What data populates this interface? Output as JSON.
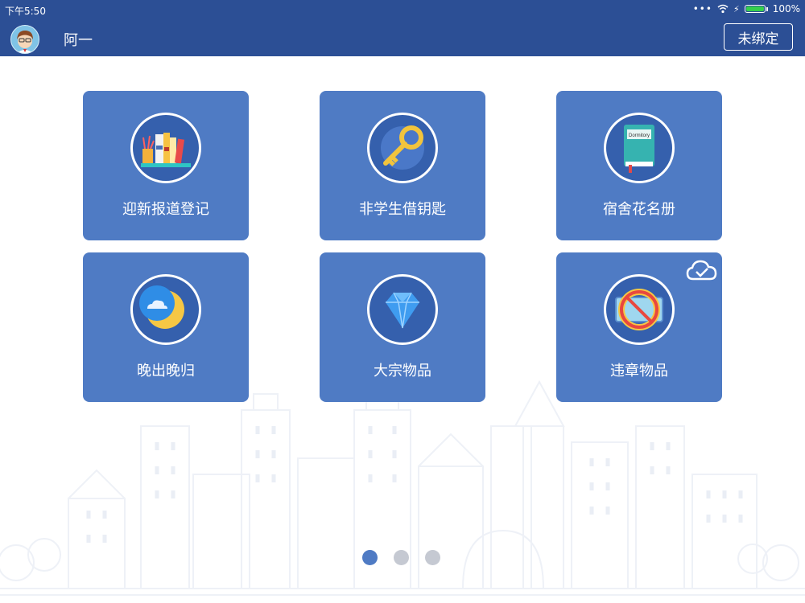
{
  "status_bar": {
    "time": "下午5:50",
    "battery": "100%"
  },
  "header": {
    "username": "阿一",
    "bind_button": "未绑定"
  },
  "tiles": [
    {
      "label": "迎新报道登记",
      "icon": "books-icon"
    },
    {
      "label": "非学生借钥匙",
      "icon": "key-icon"
    },
    {
      "label": "宿舍花名册",
      "icon": "dormitory-book-icon",
      "book_text": "Dormitory"
    },
    {
      "label": "晚出晚归",
      "icon": "moon-icon"
    },
    {
      "label": "大宗物品",
      "icon": "diamond-icon"
    },
    {
      "label": "违章物品",
      "icon": "prohibited-icon",
      "badge": "cloud-check-icon"
    }
  ],
  "pagination": {
    "pages": 3,
    "current": 1
  },
  "colors": {
    "header": "#2c4f95",
    "tile": "#4f7bc4",
    "dot_active": "#4f7bc4",
    "dot_inactive": "#c5c9d2"
  }
}
